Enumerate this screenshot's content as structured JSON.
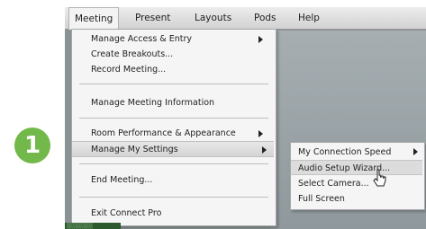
{
  "menubar": {
    "items": [
      "Meeting",
      "Present",
      "Layouts",
      "Pods",
      "Help"
    ],
    "active": "Meeting"
  },
  "meeting_menu": {
    "items": [
      {
        "label": "Manage Access & Entry",
        "submenu": true
      },
      {
        "label": "Create Breakouts...",
        "submenu": false
      },
      {
        "label": "Record Meeting...",
        "submenu": false
      },
      {
        "label": "Manage Meeting Information",
        "submenu": false
      },
      {
        "label": "Room Performance & Appearance",
        "submenu": true
      },
      {
        "label": "Manage My Settings",
        "submenu": true,
        "highlighted": true
      },
      {
        "label": "End Meeting...",
        "submenu": false
      },
      {
        "label": "Exit Connect Pro",
        "submenu": false
      }
    ]
  },
  "settings_submenu": {
    "items": [
      {
        "label": "My Connection Speed",
        "submenu": true
      },
      {
        "label": "Audio Setup Wizard...",
        "submenu": false,
        "highlighted": true
      },
      {
        "label": "Select Camera...",
        "submenu": false
      },
      {
        "label": "Full Screen",
        "submenu": false
      }
    ]
  },
  "step_badge": {
    "number": "1",
    "color": "#73b84a"
  },
  "status_strip": {
    "text": "░░░░░░░░"
  },
  "colors": {
    "highlight": "#d8d8d8",
    "menu_bg": "#f5f5f5",
    "app_bg": "#8a9294"
  }
}
